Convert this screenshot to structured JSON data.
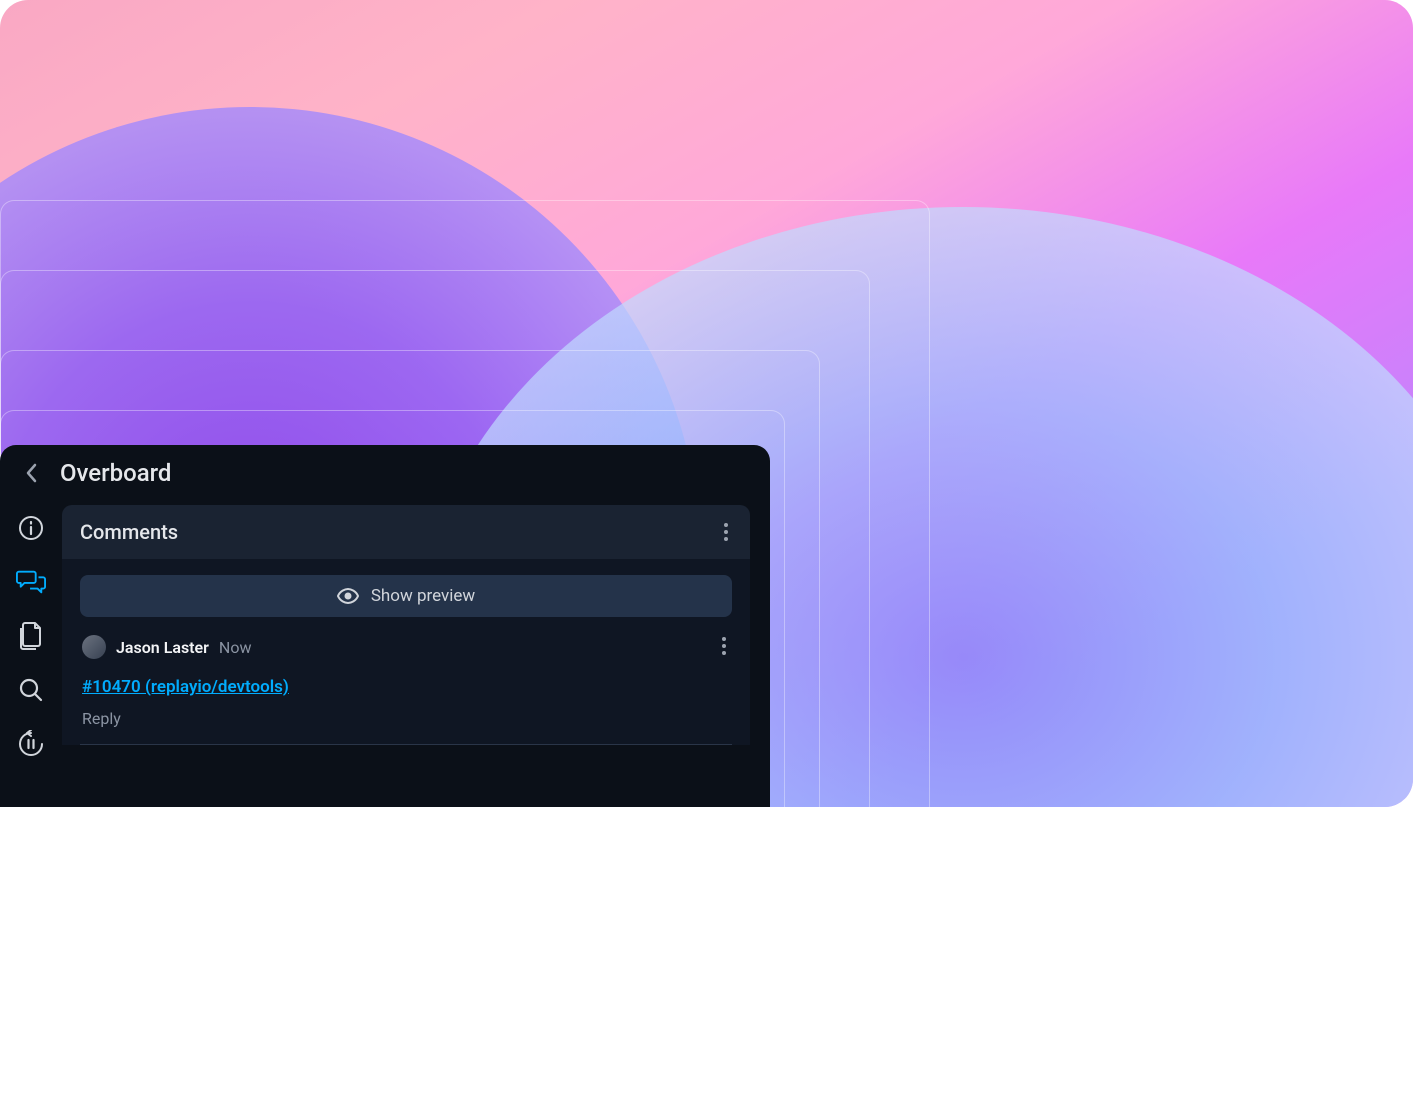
{
  "panel": {
    "title": "Overboard",
    "comments_section_title": "Comments",
    "show_preview_label": "Show preview"
  },
  "comment": {
    "author": "Jason Laster",
    "timestamp": "Now",
    "link_text": "#10470 (replayio/devtools)",
    "reply_label": "Reply"
  },
  "colors": {
    "accent": "#01acfd",
    "panel_bg": "#0b1018",
    "section_bg": "#1a2332"
  }
}
